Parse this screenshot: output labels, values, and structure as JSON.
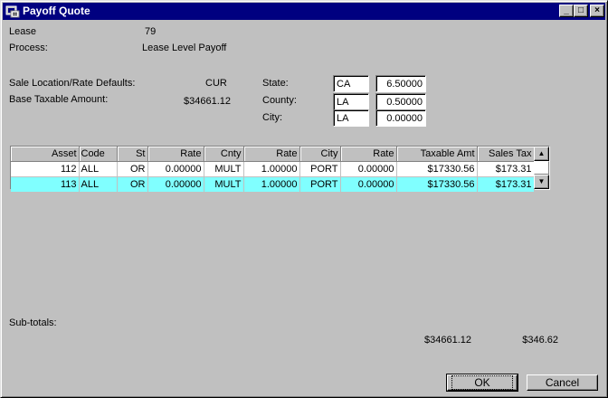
{
  "window": {
    "title": "Payoff Quote"
  },
  "header": {
    "lease_label": "Lease",
    "lease_value": "79",
    "process_label": "Process:",
    "process_value": "Lease Level Payoff"
  },
  "defaults": {
    "sale_location_label": "Sale Location/Rate Defaults:",
    "sale_location_value": "CUR",
    "base_taxable_label": "Base Taxable Amount:",
    "base_taxable_value": "$34661.12"
  },
  "tax": {
    "state_label": "State:",
    "state_code": "CA",
    "state_rate": "6.50000",
    "county_label": "County:",
    "county_code": "LA",
    "county_rate": "0.50000",
    "city_label": "City:",
    "city_code": "LA",
    "city_rate": "0.00000"
  },
  "grid": {
    "columns": [
      "Asset",
      "Code",
      "St",
      "Rate",
      "Cnty",
      "Rate",
      "City",
      "Rate",
      "Taxable Amt",
      "Sales Tax"
    ],
    "rows": [
      [
        "112",
        "ALL",
        "OR",
        "0.00000",
        "MULT",
        "1.00000",
        "PORT",
        "0.00000",
        "$17330.56",
        "$173.31"
      ],
      [
        "113",
        "ALL",
        "OR",
        "0.00000",
        "MULT",
        "1.00000",
        "PORT",
        "0.00000",
        "$17330.56",
        "$173.31"
      ]
    ],
    "selected_row": 1
  },
  "subtotals": {
    "label": "Sub-totals:",
    "taxable_total": "$34661.12",
    "sales_tax_total": "$346.62"
  },
  "buttons": {
    "ok": "OK",
    "cancel": "Cancel"
  },
  "colors": {
    "titlebar": "#000080",
    "selected_row": "#80ffff",
    "face": "#c0c0c0"
  }
}
